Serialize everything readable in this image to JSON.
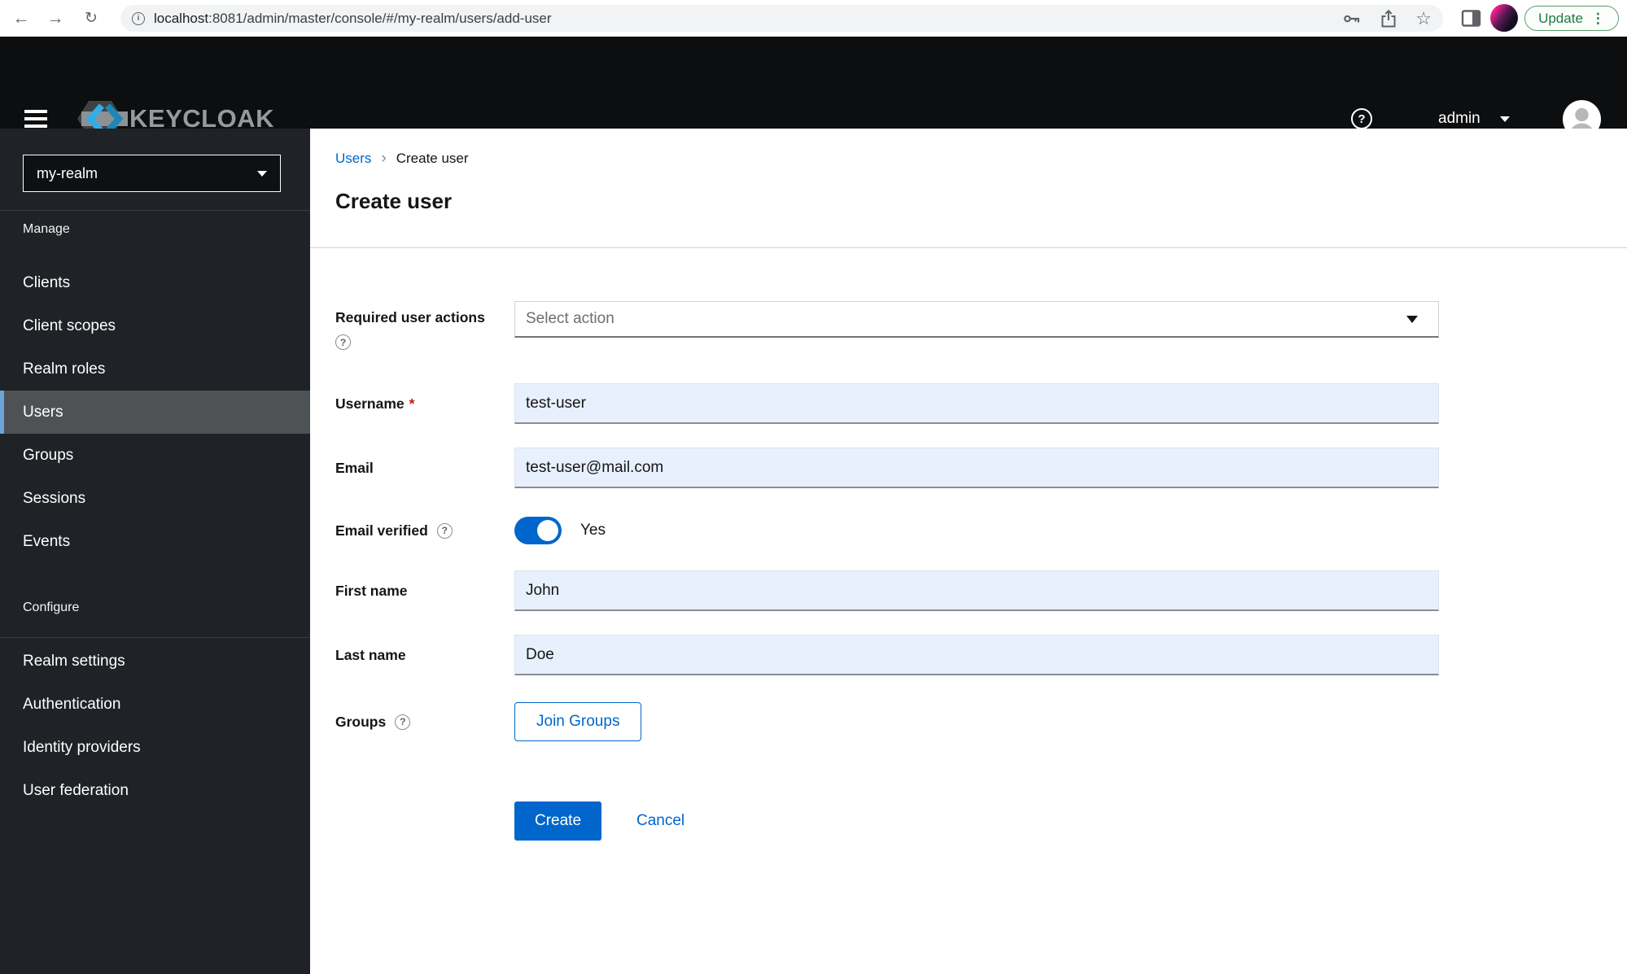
{
  "browser": {
    "url_host": "localhost",
    "url_tail": ":8081/admin/master/console/#/my-realm/users/add-user",
    "update_label": "Update"
  },
  "icons": {
    "back": "←",
    "forward": "→",
    "reload": "↻",
    "info_glyph": "i",
    "star": "☆",
    "kebab": "⋮",
    "help_glyph": "?",
    "breadcrumb_separator": "›"
  },
  "header": {
    "brand": "KEYCLOAK",
    "user": "admin"
  },
  "sidebar": {
    "realm": "my-realm",
    "manage_label": "Manage",
    "configure_label": "Configure",
    "manage_items": [
      "Clients",
      "Client scopes",
      "Realm roles",
      "Users",
      "Groups",
      "Sessions",
      "Events"
    ],
    "configure_items": [
      "Realm settings",
      "Authentication",
      "Identity providers",
      "User federation"
    ],
    "selected_item": "Users"
  },
  "breadcrumb": {
    "parent": "Users",
    "current": "Create user"
  },
  "page": {
    "title": "Create user"
  },
  "form": {
    "required_user_actions": {
      "label": "Required user actions",
      "placeholder": "Select action"
    },
    "username": {
      "label": "Username",
      "required_marker": "*",
      "value": "test-user"
    },
    "email": {
      "label": "Email",
      "value": "test-user@mail.com"
    },
    "email_verified": {
      "label": "Email verified",
      "state": "Yes"
    },
    "first_name": {
      "label": "First name",
      "value": "John"
    },
    "last_name": {
      "label": "Last name",
      "value": "Doe"
    },
    "groups": {
      "label": "Groups",
      "join_button": "Join Groups"
    },
    "actions": {
      "create": "Create",
      "cancel": "Cancel"
    }
  },
  "colors": {
    "primary_blue": "#0066cc",
    "autofill_bg": "#e8f0fe",
    "masthead_bg": "#0d0e10",
    "sidebar_bg": "#1f2226",
    "sidebar_selected_bg": "#4f5255",
    "sidebar_selected_accent": "#6ba6d9",
    "update_green": "#1d7c3f",
    "required_red": "#c9190b"
  }
}
